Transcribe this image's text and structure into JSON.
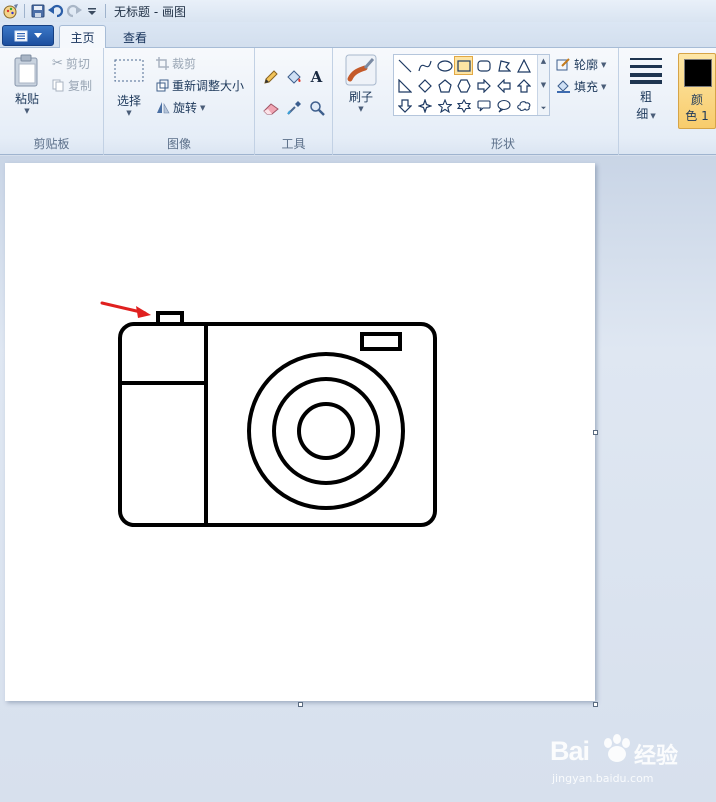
{
  "window": {
    "title": "无标题 - 画图"
  },
  "tabs": {
    "home": "主页",
    "view": "查看"
  },
  "ribbon": {
    "clipboard": {
      "group_label": "剪贴板",
      "paste": "粘贴",
      "cut": "剪切",
      "copy": "复制"
    },
    "image": {
      "group_label": "图像",
      "select": "选择",
      "crop": "裁剪",
      "resize": "重新调整大小",
      "rotate": "旋转"
    },
    "tools": {
      "group_label": "工具",
      "items": [
        "pencil-icon",
        "fill-icon",
        "text-icon",
        "eraser-icon",
        "color-picker-icon",
        "magnifier-icon"
      ]
    },
    "brushes": {
      "label": "刷子"
    },
    "shapes": {
      "group_label": "形状",
      "outline": "轮廓",
      "fill": "填充"
    },
    "size": {
      "label_line1": "粗",
      "label_line2": "细"
    },
    "color1": {
      "label_line1": "颜",
      "label_line2": "色 1",
      "value": "#000000"
    }
  },
  "watermark": {
    "brand": "Bai",
    "brand_suffix": "经验",
    "url": "jingyan.baidu.com"
  },
  "colors": {
    "accent": "#1d4f9e",
    "annotation_arrow": "#e0201f"
  }
}
